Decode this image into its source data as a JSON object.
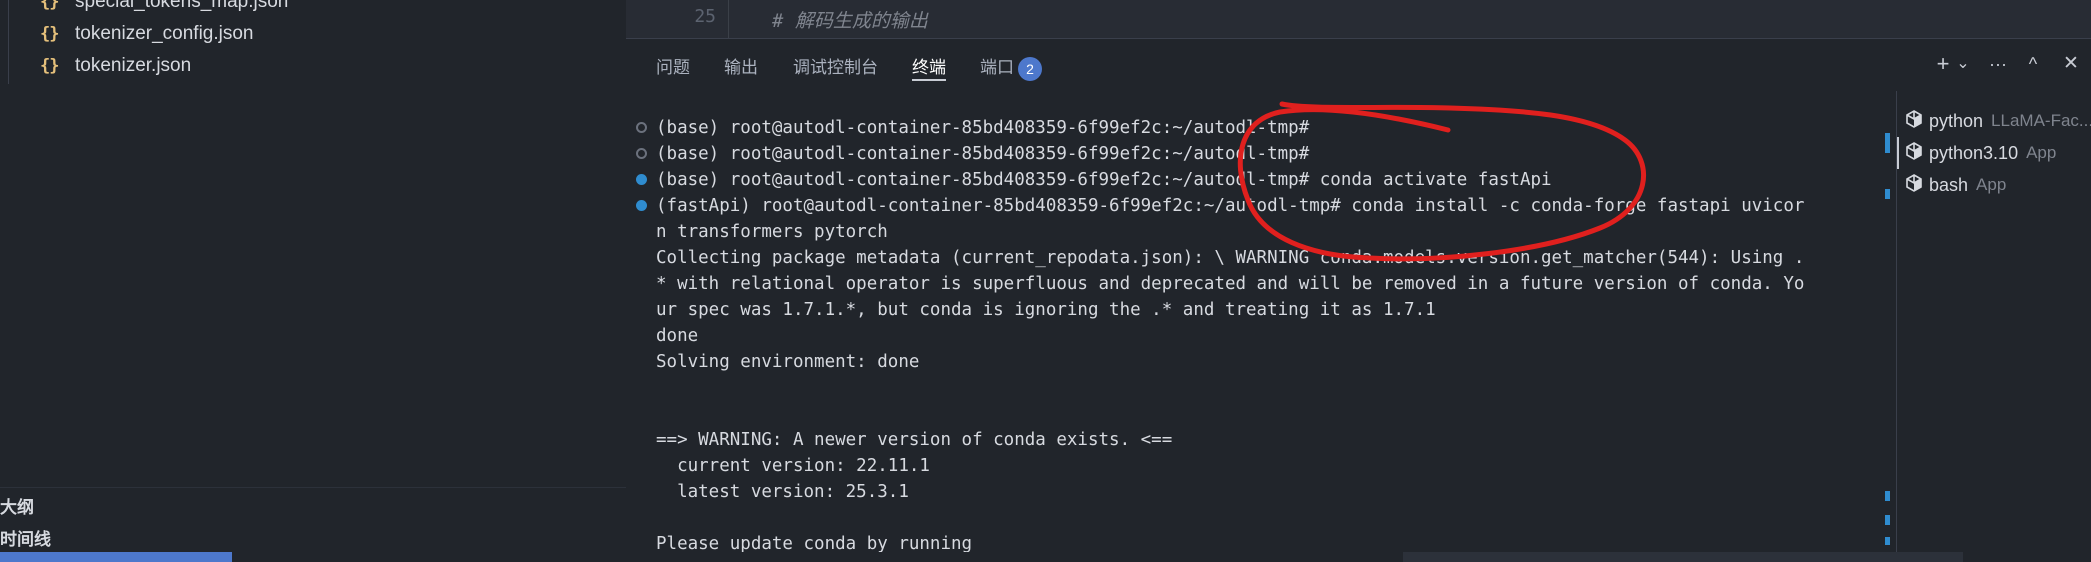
{
  "explorer": {
    "files": [
      {
        "name": "special_tokens_map.json",
        "icon": "json-file-icon",
        "glyph": "{}"
      },
      {
        "name": "tokenizer_config.json",
        "icon": "json-file-icon",
        "glyph": "{}"
      },
      {
        "name": "tokenizer.json",
        "icon": "json-file-icon",
        "glyph": "{}"
      }
    ],
    "outline_label": "大纲",
    "timeline_label": "时间线"
  },
  "editor": {
    "line_number": "25",
    "code_comment": "# 解码生成的输出"
  },
  "panel": {
    "tabs": [
      {
        "label": "问题",
        "active": false
      },
      {
        "label": "输出",
        "active": false
      },
      {
        "label": "调试控制台",
        "active": false
      },
      {
        "label": "终端",
        "active": true
      },
      {
        "label": "端口",
        "active": false,
        "badge": "2"
      }
    ],
    "actions": {
      "new_terminal": "+",
      "launch_profile": "⌄",
      "more": "···",
      "maximize": "^",
      "close": "✕"
    }
  },
  "terminal": {
    "lines": [
      {
        "text": "(base) root@autodl-container-85bd408359-6f99ef2c:~/autodl-tmp#",
        "decoration": "hollow"
      },
      {
        "text": "(base) root@autodl-container-85bd408359-6f99ef2c:~/autodl-tmp#",
        "decoration": "hollow"
      },
      {
        "text": "(base) root@autodl-container-85bd408359-6f99ef2c:~/autodl-tmp# conda activate fastApi",
        "decoration": "filled"
      },
      {
        "text": "(fastApi) root@autodl-container-85bd408359-6f99ef2c:~/autodl-tmp# conda install -c conda-forge fastapi uvicor",
        "decoration": "filled"
      },
      {
        "text": "n transformers pytorch",
        "decoration": ""
      },
      {
        "text": "Collecting package metadata (current_repodata.json): \\ WARNING conda.models.version.get_matcher(544): Using .",
        "decoration": ""
      },
      {
        "text": "* with relational operator is superfluous and deprecated and will be removed in a future version of conda. Yo",
        "decoration": ""
      },
      {
        "text": "ur spec was 1.7.1.*, but conda is ignoring the .* and treating it as 1.7.1",
        "decoration": ""
      },
      {
        "text": "done",
        "decoration": ""
      },
      {
        "text": "Solving environment: done",
        "decoration": ""
      },
      {
        "text": "",
        "decoration": ""
      },
      {
        "text": "",
        "decoration": ""
      },
      {
        "text": "==> WARNING: A newer version of conda exists. <==",
        "decoration": ""
      },
      {
        "text": "  current version: 22.11.1",
        "decoration": ""
      },
      {
        "text": "  latest version: 25.3.1",
        "decoration": ""
      },
      {
        "text": "",
        "decoration": ""
      },
      {
        "text": "Please update conda by running",
        "decoration": ""
      }
    ]
  },
  "terminal_list": [
    {
      "name": "python",
      "sub": "LLaMA-Fac...",
      "icon": "terminal-cube-icon",
      "active": false
    },
    {
      "name": "python3.10",
      "sub": "App",
      "icon": "terminal-cube-icon",
      "active": true
    },
    {
      "name": "bash",
      "sub": "App",
      "icon": "terminal-cube-icon",
      "active": false
    }
  ],
  "colors": {
    "accent": "#4d78cc",
    "decoration_blue": "#2f8ccf",
    "json_icon": "#e5c07b",
    "annotation_red": "#e0201e"
  }
}
